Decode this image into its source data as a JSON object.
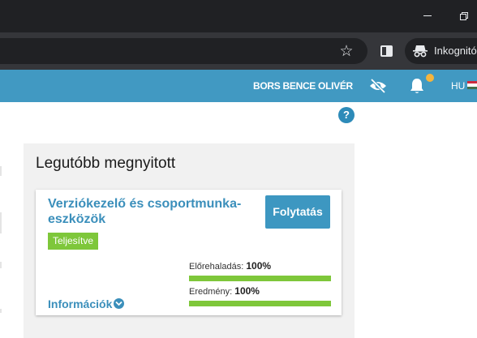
{
  "browser": {
    "incognito_label": "Inkognitó"
  },
  "header": {
    "user_name": "BORS BENCE OLIVÉR",
    "language": "HU",
    "flag_colors": [
      "#cd2a3e",
      "#ffffff",
      "#436f4d"
    ]
  },
  "recent": {
    "title": "Legutóbb megnyitott",
    "course": {
      "title": "Verziókezelő és csoportmunka-eszközök",
      "status": "Teljesítve",
      "continue_label": "Folytatás",
      "info_label": "Információk",
      "progress": {
        "label": "Előrehaladás:",
        "value_text": "100%",
        "value": 1.0
      },
      "result": {
        "label": "Eredmény:",
        "value_text": "100%",
        "value": 1.0
      }
    }
  },
  "colors": {
    "accent": "#4199c2",
    "success": "#7ec73a",
    "notification_dot": "#f5b53d"
  }
}
